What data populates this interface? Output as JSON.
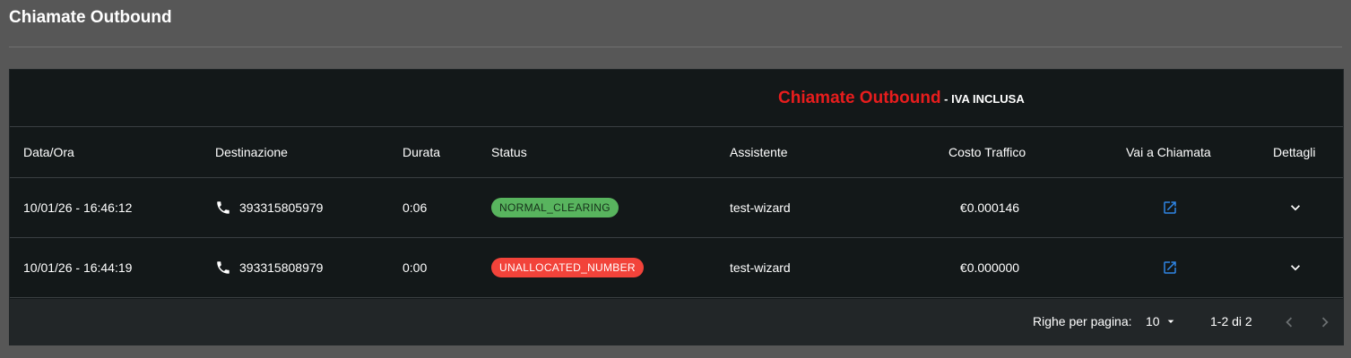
{
  "page": {
    "title": "Chiamate Outbound"
  },
  "report": {
    "title": "Chiamate Outbound",
    "separator": " - ",
    "subtitle": "IVA INCLUSA"
  },
  "table": {
    "columns": [
      "Data/Ora",
      "Destinazione",
      "Durata",
      "Status",
      "Assistente",
      "Costo Traffico",
      "Vai a Chiamata",
      "Dettagli"
    ],
    "rows": [
      {
        "datetime": "10/01/26 - 16:46:12",
        "destination": "393315805979",
        "duration": "0:06",
        "status": "NORMAL_CLEARING",
        "status_color": "#58b45e",
        "assistant": "test-wizard",
        "cost": "€0.000146"
      },
      {
        "datetime": "10/01/26 - 16:44:19",
        "destination": "393315808979",
        "duration": "0:00",
        "status": "UNALLOCATED_NUMBER",
        "status_color": "#f2433a",
        "assistant": "test-wizard",
        "cost": "€0.000000"
      }
    ]
  },
  "pagination": {
    "rows_per_page_label": "Righe per pagina:",
    "rows_per_page": "10",
    "range": "1-2 di 2"
  },
  "icons": {
    "destination": "phone-icon",
    "go_to_call": "open-in-new-icon",
    "details": "chevron-down-icon",
    "prev": "chevron-left-icon",
    "next": "chevron-right-icon"
  },
  "colors": {
    "report_title": "#e81d1d",
    "link": "#2f86e6",
    "background": "#575757",
    "card": "#131819"
  }
}
